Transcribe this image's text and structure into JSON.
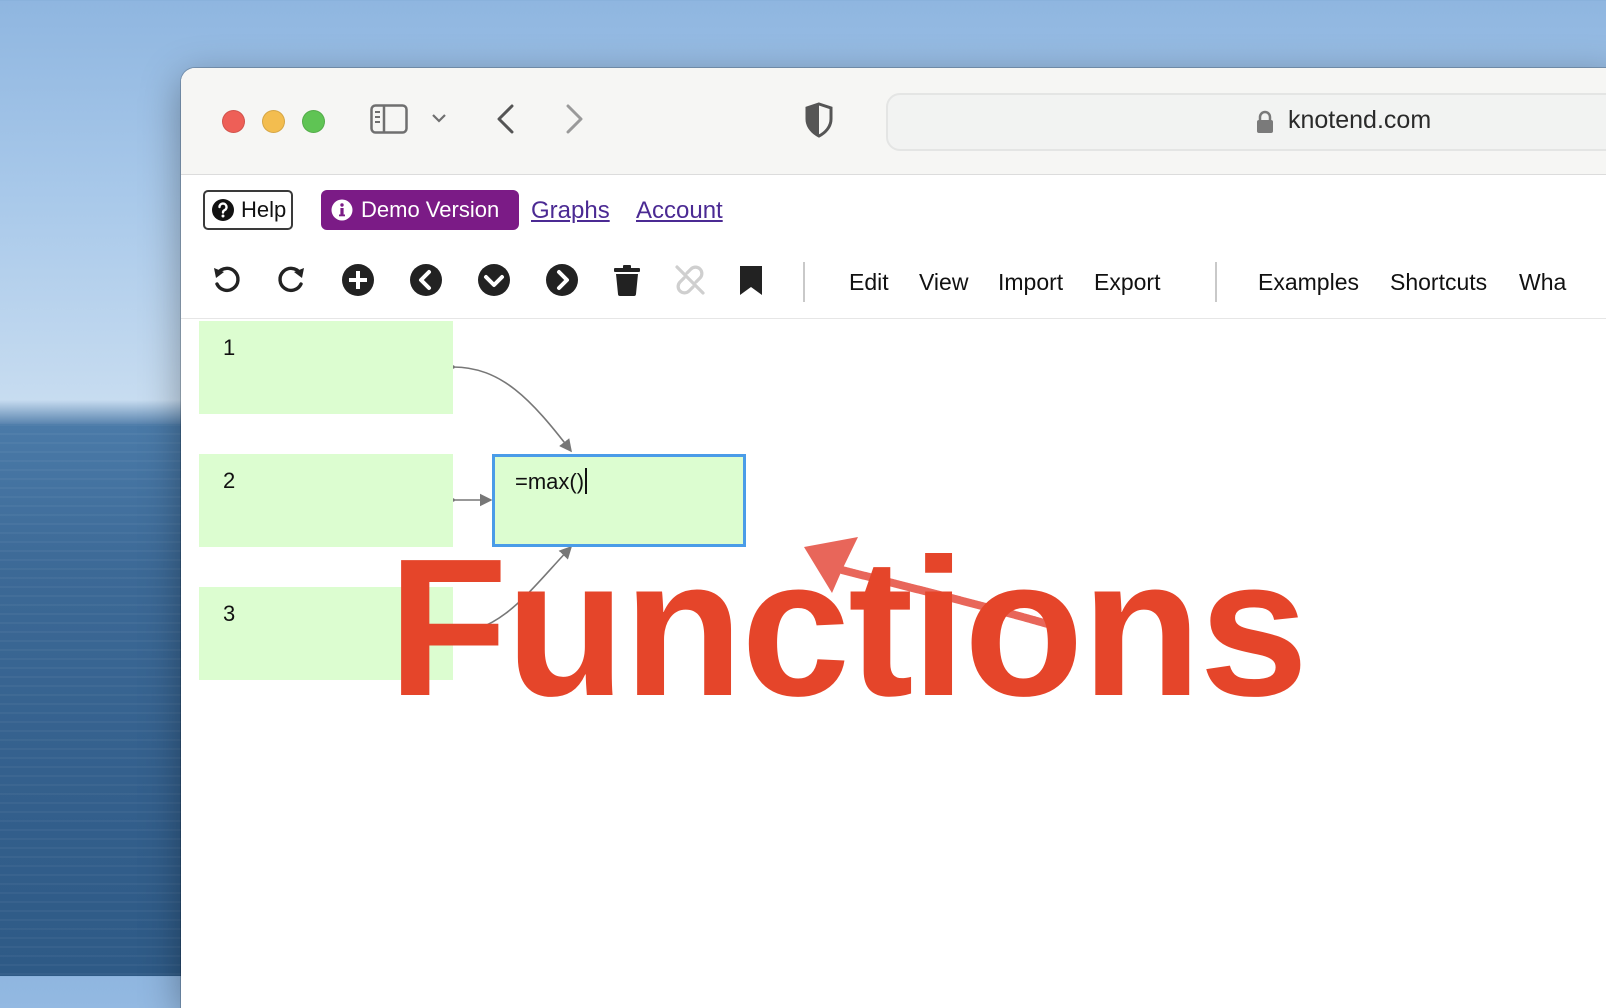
{
  "browser": {
    "url": "knotend.com",
    "traffic_lights": [
      "close",
      "minimize",
      "zoom"
    ]
  },
  "nav": {
    "help_label": "Help",
    "demo_label": "Demo Version",
    "graphs_label": "Graphs",
    "account_label": "Account"
  },
  "toolbar": {
    "icons": [
      "undo-icon",
      "redo-icon",
      "add-node-icon",
      "chevron-left-icon",
      "chevron-down-icon",
      "chevron-right-icon",
      "trash-icon",
      "unlink-icon",
      "bookmark-icon"
    ],
    "menus": [
      "Edit",
      "View",
      "Import",
      "Export"
    ],
    "menus_right": [
      "Examples",
      "Shortcuts",
      "Wha"
    ]
  },
  "graph": {
    "nodes": [
      {
        "label": "1"
      },
      {
        "label": "2"
      },
      {
        "label": "3"
      },
      {
        "label": "=max()"
      }
    ]
  },
  "annotation": {
    "caption": "Functions",
    "color": "#e5452a"
  },
  "colors": {
    "node_fill": "#dcfdd0",
    "selected_border": "#4a9ce8",
    "demo_badge": "#7b1b86",
    "link": "#4b2a93"
  }
}
